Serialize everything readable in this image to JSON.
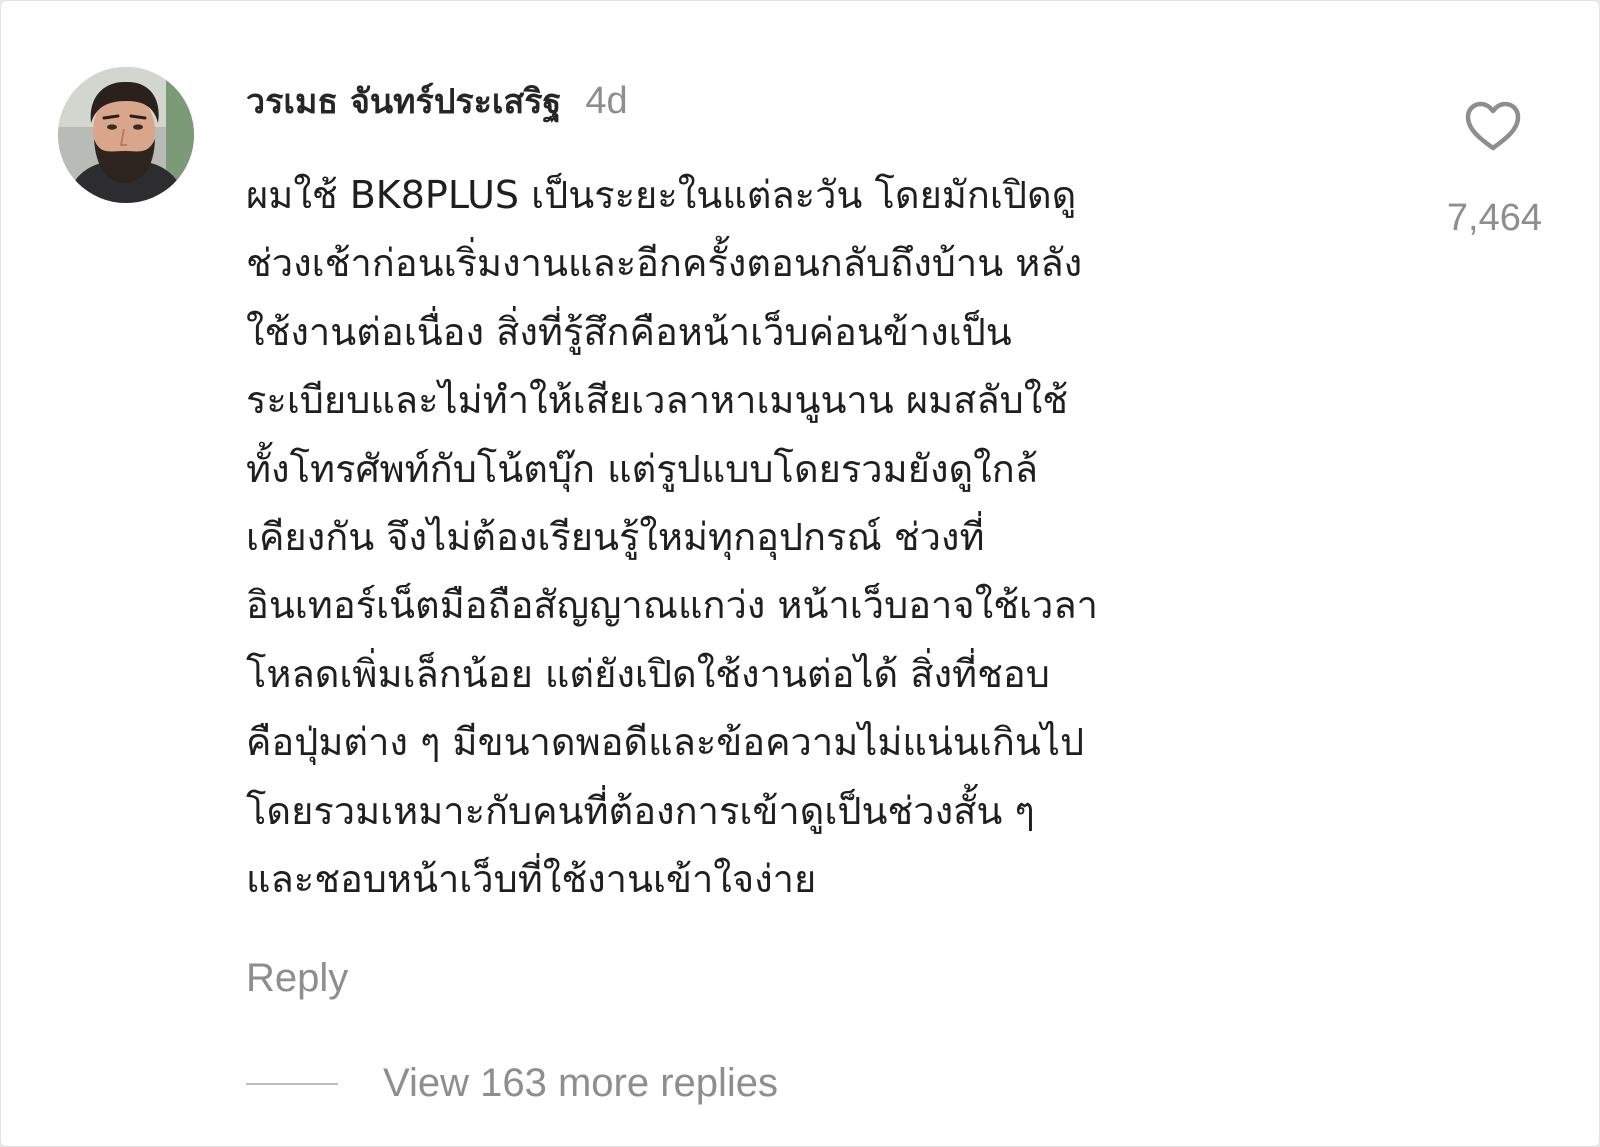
{
  "comment": {
    "avatar_icon": "user-avatar-photo",
    "username": "วรเมธ จันทร์ประเสริฐ",
    "timestamp": "4d",
    "text_lines": [
      "ผมใช้ BK8PLUS เป็นระยะในแต่ละวัน โดยมักเปิดดู",
      "ช่วงเช้าก่อนเริ่มงานและอีกครั้งตอนกลับถึงบ้าน หลัง",
      "ใช้งานต่อเนื่อง สิ่งที่รู้สึกคือหน้าเว็บค่อนข้างเป็น",
      "ระเบียบและไม่ทำให้เสียเวลาหาเมนูนาน ผมสลับใช้",
      "ทั้งโทรศัพท์กับโน้ตบุ๊ก แต่รูปแบบโดยรวมยังดูใกล้",
      "เคียงกัน จึงไม่ต้องเรียนรู้ใหม่ทุกอุปกรณ์ ช่วงที่",
      "อินเทอร์เน็ตมือถือสัญญาณแกว่ง หน้าเว็บอาจใช้เวลา",
      "โหลดเพิ่มเล็กน้อย แต่ยังเปิดใช้งานต่อได้ สิ่งที่ชอบ",
      "คือปุ่มต่าง ๆ มีขนาดพอดีและข้อความไม่แน่นเกินไป",
      "โดยรวมเหมาะกับคนที่ต้องการเข้าดูเป็นช่วงสั้น ๆ",
      "และชอบหน้าเว็บที่ใช้งานเข้าใจง่าย"
    ],
    "reply_label": "Reply",
    "like_icon": "heart-outline-icon",
    "like_count": "7,464",
    "view_replies_label": "View 163 more replies"
  }
}
